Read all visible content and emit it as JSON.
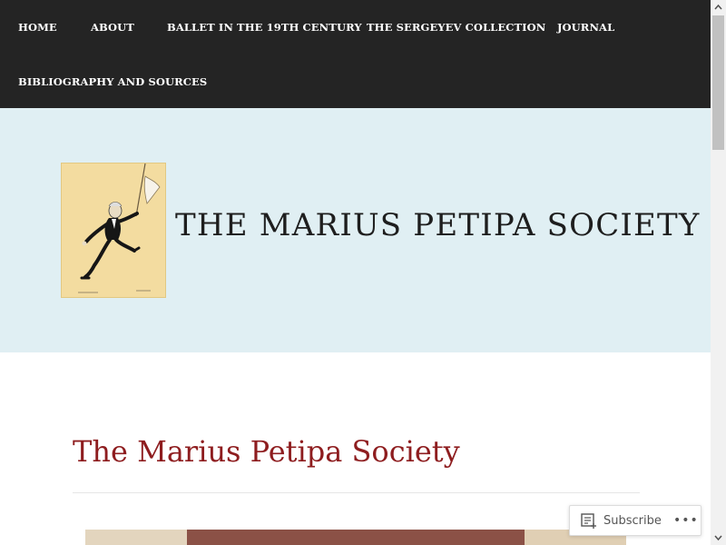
{
  "nav": {
    "items": [
      {
        "label": "HOME"
      },
      {
        "label": "ABOUT"
      },
      {
        "label": "BALLET IN THE 19TH CENTURY"
      },
      {
        "label": "THE SERGEYEV COLLECTION"
      },
      {
        "label": "JOURNAL"
      },
      {
        "label": "BIBLIOGRAPHY AND SOURCES"
      }
    ]
  },
  "header": {
    "site_title": "THE MARIUS PETIPA SOCIETY",
    "logo_icon": "caricature-dancer-with-flag"
  },
  "main": {
    "page_title": "The Marius Petipa Society"
  },
  "subscribe": {
    "label": "Subscribe",
    "icon": "reader-icon",
    "more_label": "•••"
  },
  "colors": {
    "nav_bg": "#242424",
    "header_bg": "#e0eff3",
    "page_title": "#8e1d1f",
    "site_title": "#1e1e1e"
  }
}
